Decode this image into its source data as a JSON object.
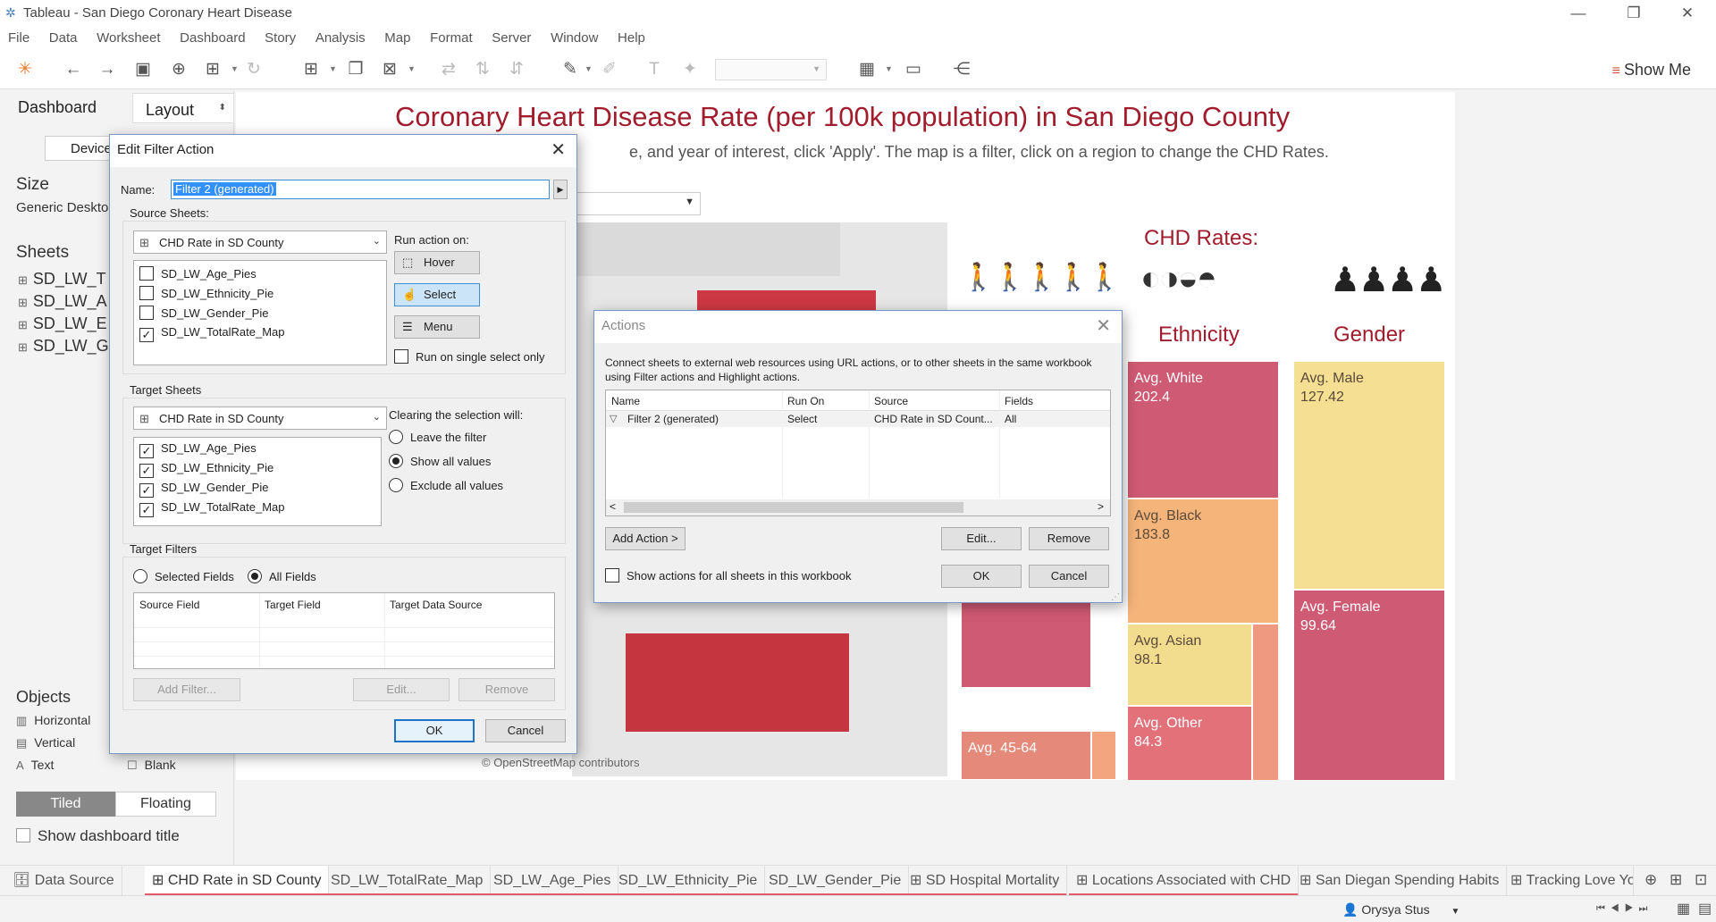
{
  "window": {
    "title": "Tableau - San Diego Coronary Heart Disease",
    "minimize_glyph": "—",
    "restore_glyph": "❐",
    "close_glyph": "✕"
  },
  "menu": [
    "File",
    "Data",
    "Worksheet",
    "Dashboard",
    "Story",
    "Analysis",
    "Map",
    "Format",
    "Server",
    "Window",
    "Help"
  ],
  "toolbar": {
    "show_me": "Show Me"
  },
  "left_pane": {
    "tab_dashboard": "Dashboard",
    "tab_layout": "Layout",
    "device_button": "Device",
    "size_header": "Size",
    "size_value": "Generic Deskto",
    "sheets_header": "Sheets",
    "sheets": [
      "SD_LW_T",
      "SD_LW_A",
      "SD_LW_E",
      "SD_LW_G"
    ],
    "objects_header": "Objects",
    "objects": {
      "horizontal": "Horizontal",
      "vertical": "Vertical",
      "text": "Text",
      "blank": "Blank"
    },
    "tiled": "Tiled",
    "floating": "Floating",
    "show_dashboard_title": "Show dashboard title"
  },
  "dashboard": {
    "title": "Coronary Heart Disease Rate (per 100k population) in San Diego County",
    "subtitle": "e, and year of interest, click 'Apply'. The map is a filter, click on a region to change the CHD Rates.",
    "osm_credit": "© OpenStreetMap contributors",
    "chd_rates_header": "CHD Rates:",
    "ethnicity_header": "Ethnicity",
    "gender_header": "Gender",
    "age_tile": "Avg. 45-64",
    "ethnicity_tiles": [
      {
        "label": "Avg. White",
        "value": "202.4"
      },
      {
        "label": "Avg. Black",
        "value": "183.8"
      },
      {
        "label": "Avg. Asian",
        "value": "98.1"
      },
      {
        "label": "Avg. Other",
        "value": "84.3"
      }
    ],
    "gender_tiles": [
      {
        "label": "Avg. Male",
        "value": "127.42"
      },
      {
        "label": "Avg. Female",
        "value": "99.64"
      }
    ],
    "colors": {
      "title": "#a11c2c",
      "white": "#cf5a73",
      "black": "#f5b47a",
      "asian": "#f2dc8e",
      "other": "#e2717a",
      "male": "#f4df92",
      "female": "#cf5a73"
    }
  },
  "sheet_tabs": [
    "Data Source",
    "CHD Rate in SD County",
    "SD_LW_TotalRate_Map",
    "SD_LW_Age_Pies",
    "SD_LW_Ethnicity_Pie",
    "SD_LW_Gender_Pie",
    "SD Hospital Mortality",
    "Locations Associated with CHD",
    "San Diegan Spending Habits",
    "Tracking Love Yo"
  ],
  "status": {
    "user": "Orysya Stus"
  },
  "edit_filter_dialog": {
    "title": "Edit Filter Action",
    "name_label": "Name:",
    "name_value": "Filter 2 (generated)",
    "source_sheets_label": "Source Sheets:",
    "source_combo": "CHD Rate in SD County",
    "source_items": [
      {
        "name": "SD_LW_Age_Pies",
        "checked": false
      },
      {
        "name": "SD_LW_Ethnicity_Pie",
        "checked": false
      },
      {
        "name": "SD_LW_Gender_Pie",
        "checked": false
      },
      {
        "name": "SD_LW_TotalRate_Map",
        "checked": true
      }
    ],
    "run_action_label": "Run action on:",
    "hover": "Hover",
    "select": "Select",
    "menu": "Menu",
    "run_single": "Run on single select only",
    "target_sheets_label": "Target Sheets",
    "target_combo": "CHD Rate in SD County",
    "target_items": [
      {
        "name": "SD_LW_Age_Pies",
        "checked": true
      },
      {
        "name": "SD_LW_Ethnicity_Pie",
        "checked": true
      },
      {
        "name": "SD_LW_Gender_Pie",
        "checked": true
      },
      {
        "name": "SD_LW_TotalRate_Map",
        "checked": true
      }
    ],
    "clearing_label": "Clearing the selection will:",
    "leave_filter": "Leave the filter",
    "show_all": "Show all values",
    "exclude_all": "Exclude all values",
    "target_filters_label": "Target Filters",
    "selected_fields": "Selected Fields",
    "all_fields": "All Fields",
    "col_source_field": "Source Field",
    "col_target_field": "Target Field",
    "col_target_data_source": "Target Data Source",
    "add_filter": "Add Filter...",
    "edit": "Edit...",
    "remove": "Remove",
    "ok": "OK",
    "cancel": "Cancel"
  },
  "actions_dialog": {
    "title": "Actions",
    "description": "Connect sheets to external web resources using URL actions, or to other sheets in the same workbook using Filter actions and Highlight actions.",
    "columns": [
      "Name",
      "Run On",
      "Source",
      "Fields"
    ],
    "rows": [
      {
        "name": "Filter 2 (generated)",
        "run_on": "Select",
        "source": "CHD Rate in SD Count...",
        "fields": "All"
      }
    ],
    "add_action": "Add Action >",
    "edit": "Edit...",
    "remove": "Remove",
    "show_all_sheets": "Show actions for all sheets in this workbook",
    "ok": "OK",
    "cancel": "Cancel"
  }
}
